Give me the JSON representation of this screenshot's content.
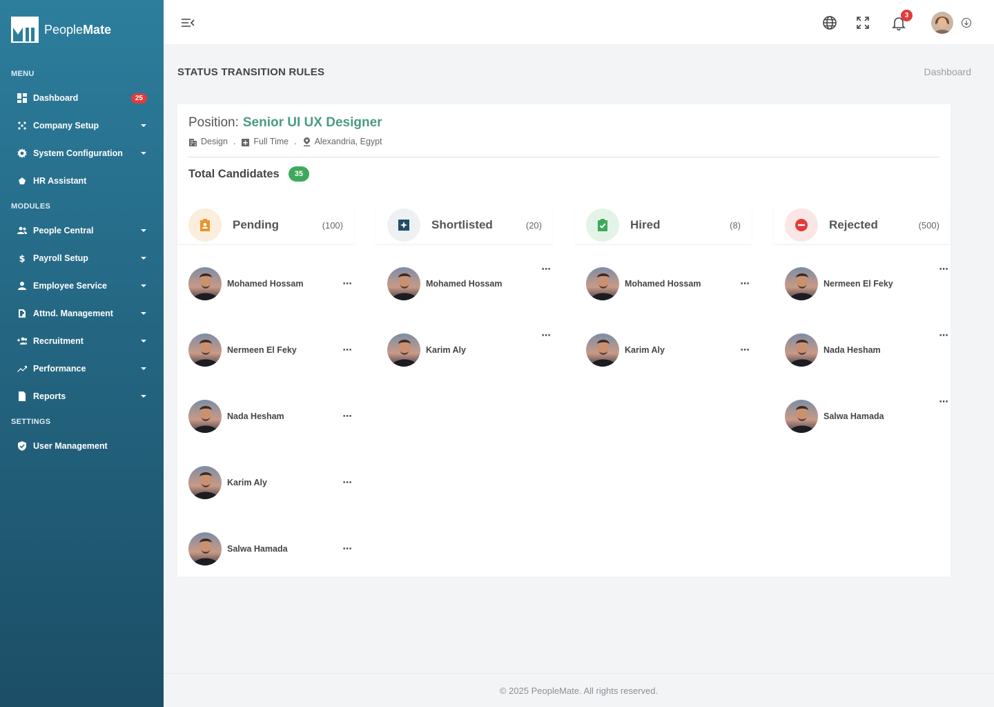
{
  "brand": {
    "name_light": "People",
    "name_bold": "Mate"
  },
  "sidebar": {
    "sections": {
      "menu": "MENU",
      "modules": "MODULES",
      "settings": "SETTINGS"
    },
    "items": [
      {
        "label": "Dashboard",
        "icon": "dashboard-icon",
        "badge": "25"
      },
      {
        "label": "Company Setup",
        "icon": "company-icon"
      },
      {
        "label": "System Configuration",
        "icon": "gear-icon"
      },
      {
        "label": "HR Assistant",
        "icon": "assistant-icon"
      },
      {
        "label": "People Central",
        "icon": "people-icon"
      },
      {
        "label": "Payroll Setup",
        "icon": "dollar-icon"
      },
      {
        "label": "Employee Service",
        "icon": "person-icon"
      },
      {
        "label": "Attnd. Management",
        "icon": "attendance-icon"
      },
      {
        "label": "Recruitment",
        "icon": "recruitment-icon"
      },
      {
        "label": "Performance",
        "icon": "trend-icon"
      },
      {
        "label": "Reports",
        "icon": "report-icon"
      },
      {
        "label": "User Management",
        "icon": "shield-icon"
      }
    ]
  },
  "topbar": {
    "notifications_count": "3"
  },
  "page": {
    "title": "STATUS TRANSITION RULES",
    "breadcrumb": "Dashboard"
  },
  "position": {
    "label": "Position:",
    "title": "Senior UI UX Designer",
    "department": "Design",
    "type": "Full Time",
    "location": "Alexandria, Egypt",
    "sep": "."
  },
  "total": {
    "label": "Total Candidates",
    "count": "35"
  },
  "columns": [
    {
      "name": "Pending",
      "count": "(100)",
      "color": "#e8962d",
      "bg": "#fbeedd",
      "candidates": [
        "Mohamed Hossam",
        "Nermeen El Feky",
        "Nada Hesham",
        "Karim Aly",
        "Salwa Hamada"
      ]
    },
    {
      "name": "Shortlisted",
      "count": "(20)",
      "color": "#1f4e66",
      "bg": "#eef1f3",
      "candidates": [
        "Mohamed Hossam",
        "Karim Aly"
      ]
    },
    {
      "name": "Hired",
      "count": "(8)",
      "color": "#3ea95c",
      "bg": "#e3f3e8",
      "candidates": [
        "Mohamed Hossam",
        "Karim Aly"
      ]
    },
    {
      "name": "Rejected",
      "count": "(500)",
      "color": "#e23b3b",
      "bg": "#fbe6e6",
      "candidates": [
        "Nermeen El Feky",
        "Nada Hesham",
        "Salwa Hamada"
      ]
    }
  ],
  "more_label": "⋯",
  "footer": "© 2025  PeopleMate. All rights reserved."
}
